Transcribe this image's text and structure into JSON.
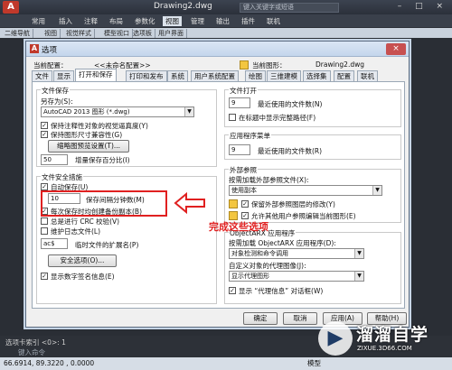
{
  "app": {
    "logo": "A",
    "title": "Drawing2.dwg",
    "search_placeholder": "键入关键字或短语",
    "window_controls": "– □ ×",
    "ribbon_tabs": [
      "常用",
      "插入",
      "注释",
      "布局",
      "参数化",
      "视图",
      "管理",
      "输出",
      "插件",
      "联机"
    ],
    "active_ribbon_tab": "视图",
    "doc_tabs": [
      "二维导航",
      "视图",
      "视觉样式",
      "模型视口",
      "选项板",
      "用户界面"
    ]
  },
  "dialog": {
    "title": "选项",
    "close": "×",
    "current_profile_label": "当前配置：",
    "current_profile_value": "<<未命名配置>>",
    "current_drawing_label": "当前图形：",
    "current_drawing_value": "Drawing2.dwg",
    "tabs": [
      "文件",
      "显示",
      "打开和保存",
      "打印和发布",
      "系统",
      "用户系统配置",
      "绘图",
      "三维建模",
      "选择集",
      "配置",
      "联机"
    ],
    "active_tab": "打开和保存",
    "file_save": {
      "group_title": "文件保存",
      "save_as_label": "另存为(S):",
      "save_as_value": "AutoCAD 2013 图形 (*.dwg)",
      "cb_visual_fidelity": "保持注释性对象的视觉逼真度(Y)",
      "cb_drawing_size": "保持图形尺寸兼容性(G)",
      "thumb_button": "缩略图预览设置(T)...",
      "incremental_value": "50",
      "incremental_label": "增量保存百分比(I)"
    },
    "file_safety": {
      "group_title": "文件安全措施",
      "cb_autosave": "自动保存(U)",
      "autosave_value": "10",
      "autosave_label": "保存间隔分钟数(M)",
      "cb_backup": "每次保存时均创建备份副本(B)",
      "cb_crc": "总是进行 CRC 校验(V)",
      "cb_log": "维护日志文件(L)",
      "temp_ext_value": "ac$",
      "temp_ext_label": "临时文件的扩展名(P)",
      "security_button": "安全选项(O)...",
      "cb_signature": "显示数字签名信息(E)"
    },
    "file_open": {
      "group_title": "文件打开",
      "recent_files_value": "9",
      "recent_files_label": "最近使用的文件数(N)",
      "cb_full_path": "在标题中显示完整路径(F)"
    },
    "app_menu": {
      "group_title": "应用程序菜单",
      "recent_value": "9",
      "recent_label": "最近使用的文件数(R)"
    },
    "xref": {
      "group_title": "外部参照",
      "demand_load_label": "按需加载外部参照文件(X):",
      "demand_load_value": "使用副本",
      "cb_retain_layer": "保留外部参照图层的修改(Y)",
      "cb_allow_edit": "允许其他用户参照编辑当前图形(E)"
    },
    "objectarx": {
      "group_title": "ObjectARX 应用程序",
      "demand_load_label": "按需加载 ObjectARX 应用程序(D):",
      "demand_load_value": "对象检测和命令调用",
      "proxy_label": "自定义对象的代理图像(J):",
      "proxy_value": "显示代理图形",
      "cb_proxy_dialog": "显示 “代理信息” 对话框(W)"
    },
    "buttons": {
      "ok": "确定",
      "cancel": "取消",
      "apply": "应用(A)",
      "help": "帮助(H)"
    }
  },
  "annotation": {
    "text": "完成这些选项"
  },
  "command_line": {
    "line1": "选项卡索引 <0>: 1",
    "prompt": "键入命令"
  },
  "status_bar": {
    "coords": "66.6914, 89.3220 , 0.0000",
    "model_label": "模型"
  },
  "watermark": {
    "logo": "▶",
    "title": "溜溜自学",
    "url": "ZIXUE.3D66.COM"
  },
  "colors": {
    "annotation_red": "#e02020",
    "accent_blue": "#1f3c66"
  }
}
